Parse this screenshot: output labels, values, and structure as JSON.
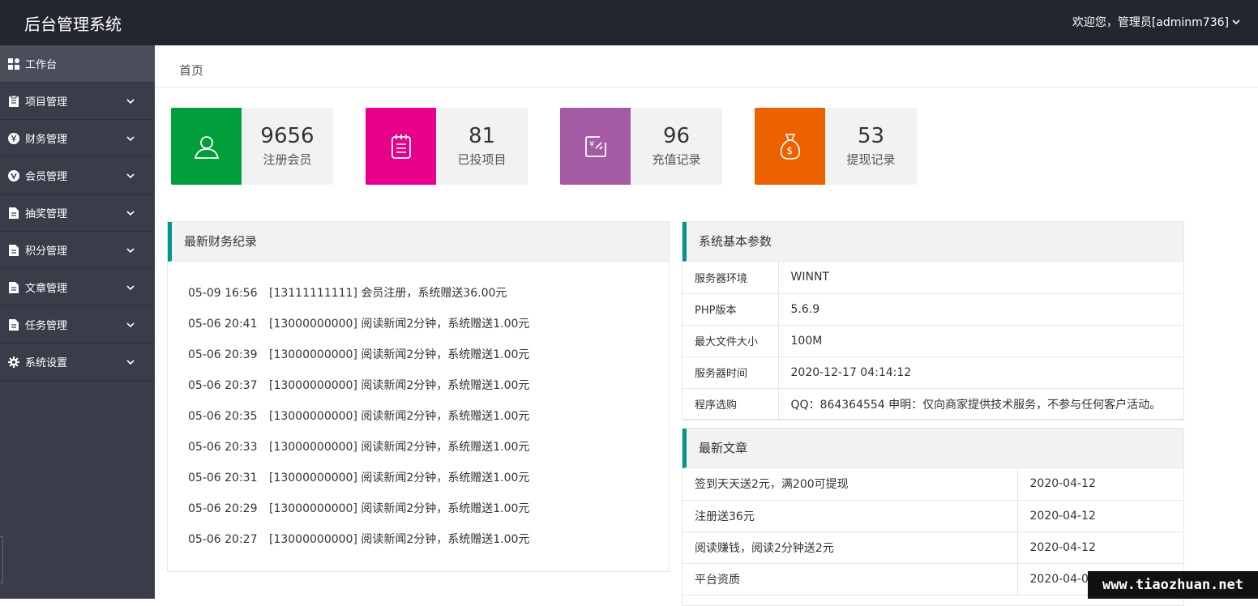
{
  "header": {
    "title": "后台管理系统",
    "user_greeting": "欢迎您，管理员[adminm736]"
  },
  "sidebar": {
    "items": [
      {
        "label": "工作台",
        "icon": "dashboard-icon",
        "expandable": false
      },
      {
        "label": "项目管理",
        "icon": "clipboard-icon",
        "expandable": true
      },
      {
        "label": "财务管理",
        "icon": "yen-circle-icon",
        "expandable": true
      },
      {
        "label": "会员管理",
        "icon": "v-circle-icon",
        "expandable": true
      },
      {
        "label": "抽奖管理",
        "icon": "document-icon",
        "expandable": true
      },
      {
        "label": "积分管理",
        "icon": "document-icon",
        "expandable": true
      },
      {
        "label": "文章管理",
        "icon": "document-icon",
        "expandable": true
      },
      {
        "label": "任务管理",
        "icon": "document-icon",
        "expandable": true
      },
      {
        "label": "系统设置",
        "icon": "gear-icon",
        "expandable": true
      }
    ]
  },
  "breadcrumb": {
    "home": "首页"
  },
  "stats": [
    {
      "value": "9656",
      "label": "注册会员",
      "icon": "user-icon",
      "color": "#009f3c"
    },
    {
      "value": "81",
      "label": "已投项目",
      "icon": "notepad-icon",
      "color": "#e8008a"
    },
    {
      "value": "96",
      "label": "充值记录",
      "icon": "recharge-icon",
      "color": "#a55ba4"
    },
    {
      "value": "53",
      "label": "提现记录",
      "icon": "money-bag-icon",
      "color": "#ec6100"
    }
  ],
  "finance_panel": {
    "title": "最新财务纪录",
    "rows": [
      {
        "time": "05-09 16:56",
        "text": "[13111111111] 会员注册，系统赠送36.00元"
      },
      {
        "time": "05-06 20:41",
        "text": "[13000000000] 阅读新闻2分钟，系统赠送1.00元"
      },
      {
        "time": "05-06 20:39",
        "text": "[13000000000] 阅读新闻2分钟，系统赠送1.00元"
      },
      {
        "time": "05-06 20:37",
        "text": "[13000000000] 阅读新闻2分钟，系统赠送1.00元"
      },
      {
        "time": "05-06 20:35",
        "text": "[13000000000] 阅读新闻2分钟，系统赠送1.00元"
      },
      {
        "time": "05-06 20:33",
        "text": "[13000000000] 阅读新闻2分钟，系统赠送1.00元"
      },
      {
        "time": "05-06 20:31",
        "text": "[13000000000] 阅读新闻2分钟，系统赠送1.00元"
      },
      {
        "time": "05-06 20:29",
        "text": "[13000000000] 阅读新闻2分钟，系统赠送1.00元"
      },
      {
        "time": "05-06 20:27",
        "text": "[13000000000] 阅读新闻2分钟，系统赠送1.00元"
      }
    ]
  },
  "system_panel": {
    "title": "系统基本参数",
    "rows": [
      {
        "key": "服务器环境",
        "value": "WINNT"
      },
      {
        "key": "PHP版本",
        "value": "5.6.9"
      },
      {
        "key": "最大文件大小",
        "value": "100M"
      },
      {
        "key": "服务器时间",
        "value": "2020-12-17 04:14:12"
      },
      {
        "key": "程序选购",
        "value": "QQ：864364554 申明：仅向商家提供技术服务，不参与任何客户活动。"
      }
    ]
  },
  "articles_panel": {
    "title": "最新文章",
    "rows": [
      {
        "title": "签到天天送2元，满200可提现",
        "date": "2020-04-12"
      },
      {
        "title": "注册送36元",
        "date": "2020-04-12"
      },
      {
        "title": "阅读赚钱，阅读2分钟送2元",
        "date": "2020-04-12"
      },
      {
        "title": "平台资质",
        "date": "2020-04-07"
      }
    ]
  },
  "watermark": "www.tiaozhuan.net",
  "colors": {
    "header_bg": "#23262e",
    "sidebar_bg": "#393d49",
    "accent": "#009688"
  }
}
